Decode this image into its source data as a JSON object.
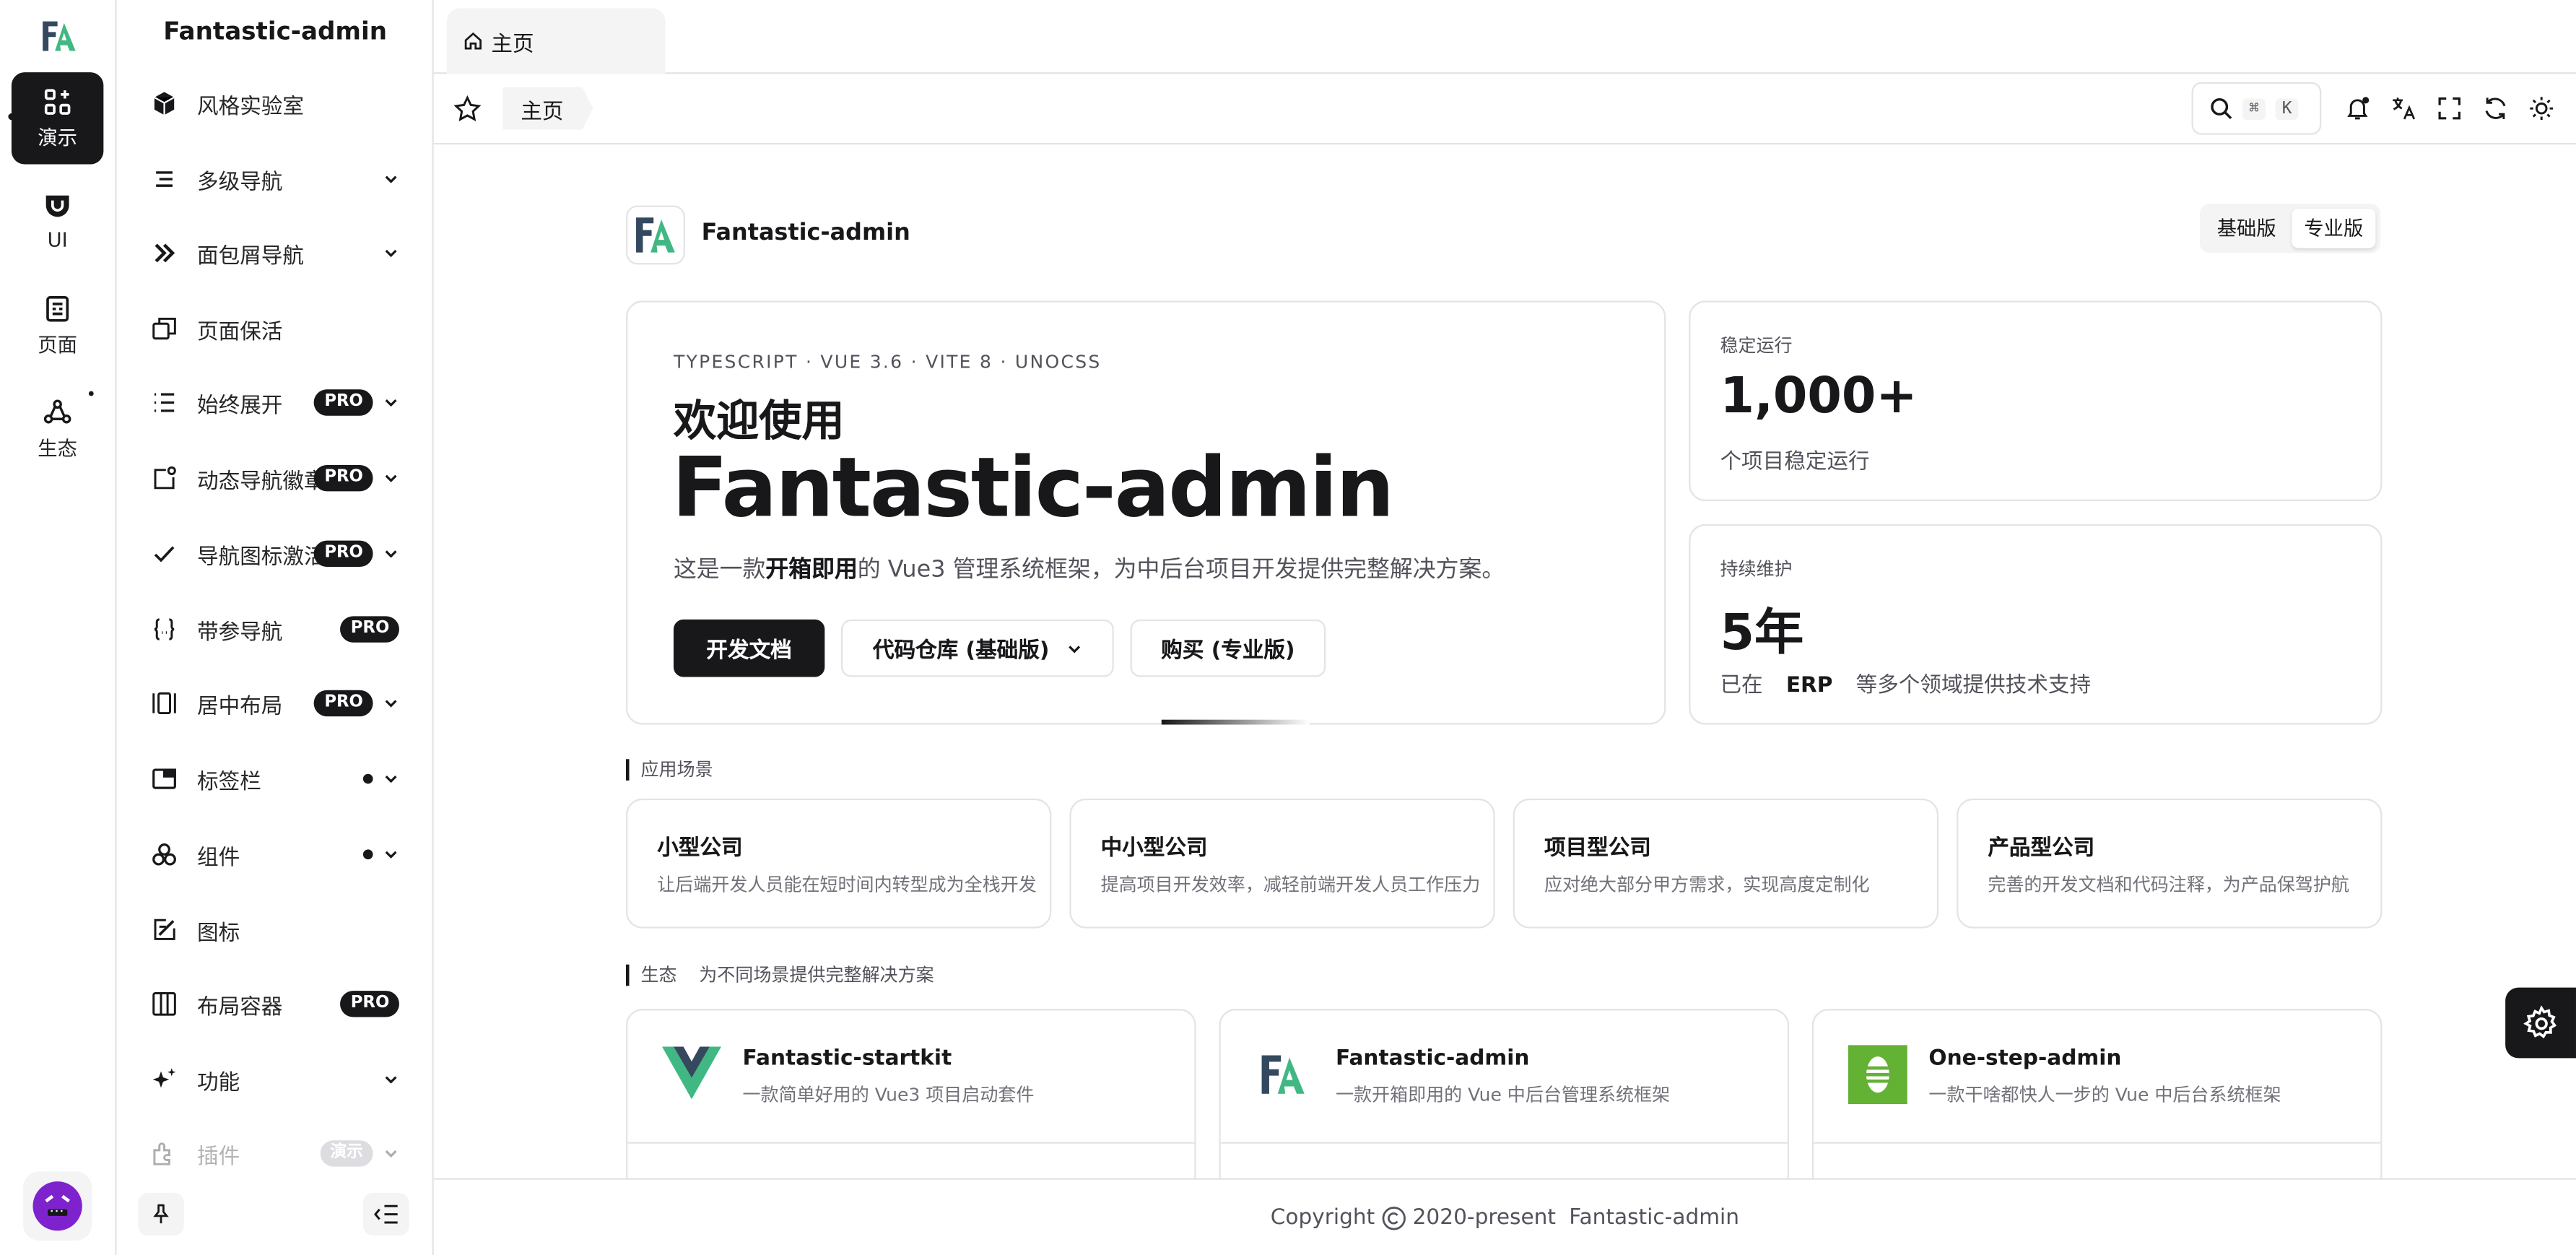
{
  "app": {
    "title": "Fantastic-admin"
  },
  "main_nav": [
    {
      "label": "演示",
      "icon": "apps-add-icon"
    },
    {
      "label": "UI",
      "icon": "ui-icon"
    },
    {
      "label": "页面",
      "icon": "page-icon"
    },
    {
      "label": "生态",
      "icon": "ecosystem-icon"
    }
  ],
  "sub_nav": [
    {
      "label": "风格实验室",
      "icon": "cube-icon"
    },
    {
      "label": "多级导航",
      "icon": "menu-icon"
    },
    {
      "label": "面包屑导航",
      "icon": "double-chevron-icon"
    },
    {
      "label": "页面保活",
      "icon": "copy-icon"
    },
    {
      "label": "始终展开",
      "icon": "list-icon",
      "badge": "PRO"
    },
    {
      "label": "动态导航徽章",
      "icon": "badge-icon",
      "badge": "PRO"
    },
    {
      "label": "导航图标激活",
      "icon": "check-icon",
      "badge": "PRO"
    },
    {
      "label": "带参导航",
      "icon": "braces-icon",
      "badge": "PRO"
    },
    {
      "label": "居中布局",
      "icon": "layout-center-icon",
      "badge": "PRO"
    },
    {
      "label": "标签栏",
      "icon": "window-icon"
    },
    {
      "label": "组件",
      "icon": "components-icon"
    },
    {
      "label": "图标",
      "icon": "icon-edit-icon"
    },
    {
      "label": "布局容器",
      "icon": "columns-icon",
      "badge": "PRO"
    },
    {
      "label": "功能",
      "icon": "sparkle-icon"
    },
    {
      "label": "插件",
      "icon": "plugin-icon",
      "badge": "演示"
    }
  ],
  "tabs": [
    {
      "label": "主页"
    }
  ],
  "breadcrumb": {
    "label": "主页"
  },
  "search": {
    "key1": "⌘",
    "key2": "K"
  },
  "hero": {
    "logo_name": "Fantastic-admin",
    "tech": "TYPESCRIPT · VUE 3.6 · VITE 8 · UNOCSS",
    "welcome": "欢迎使用",
    "name": "Fantastic-admin",
    "desc_pre": "这是一款",
    "desc_bold": "开箱即用",
    "desc_post": "的 Vue3 管理系统框架，为中后台项目开发提供完整解决方案。",
    "btn_docs": "开发文档",
    "btn_repo": "代码仓库 (基础版)",
    "btn_buy": "购买 (专业版)",
    "edition_basic": "基础版",
    "edition_pro": "专业版"
  },
  "stats": [
    {
      "label": "稳定运行",
      "value": "1,000+",
      "sub": "个项目稳定运行"
    },
    {
      "label": "持续维护",
      "value": "5年",
      "sub_pre": "已在",
      "sub_bold": "ERP",
      "sub_post": "等多个领域提供技术支持"
    }
  ],
  "scenes": {
    "title": "应用场景",
    "items": [
      {
        "title": "小型公司",
        "desc": "让后端开发人员能在短时间内转型成为全栈开发"
      },
      {
        "title": "中小型公司",
        "desc": "提高项目开发效率，减轻前端开发人员工作压力"
      },
      {
        "title": "项目型公司",
        "desc": "应对绝大部分甲方需求，实现高度定制化"
      },
      {
        "title": "产品型公司",
        "desc": "完善的开发文档和代码注释，为产品保驾护航"
      }
    ]
  },
  "ecosystem": {
    "title": "生态",
    "subtitle": "为不同场景提供完整解决方案",
    "items": [
      {
        "name": "Fantastic-startkit",
        "desc": "一款简单好用的 Vue3 项目启动套件"
      },
      {
        "name": "Fantastic-admin",
        "desc": "一款开箱即用的 Vue 中后台管理系统框架"
      },
      {
        "name": "One-step-admin",
        "desc": "一款干啥都快人一步的 Vue 中后台系统框架"
      }
    ]
  },
  "footer": {
    "copyright": "Copyright",
    "years": "2020-present",
    "owner": "Fantastic-admin"
  },
  "colors": {
    "accent": "#18181b",
    "brand_green": "#41b883",
    "brand_dark": "#34495e",
    "purple": "#7e22ce"
  }
}
